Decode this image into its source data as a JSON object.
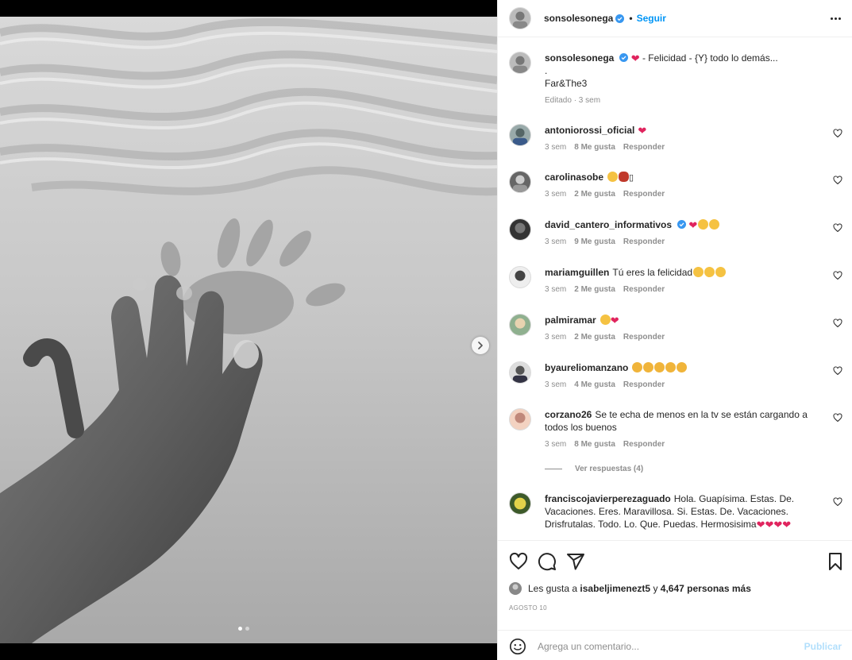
{
  "post": {
    "author": "sonsolesonega",
    "follow_label": "Seguir",
    "dot": "•",
    "caption": {
      "text": "- Felicidad - {Y} todo lo demás...",
      "line2": ".",
      "line3": "Far&The3",
      "edited": "Editado · 3 sem"
    }
  },
  "comments": [
    {
      "user": "antoniorossi_oficial",
      "text": "",
      "emojis": [
        "❤"
      ],
      "time": "3 sem",
      "likes": "8 Me gusta",
      "reply": "Responder"
    },
    {
      "user": "carolinasobe",
      "text": "",
      "emojis": [
        "🥰",
        "🌹",
        "▯"
      ],
      "time": "3 sem",
      "likes": "2 Me gusta",
      "reply": "Responder"
    },
    {
      "user": "david_cantero_informativos",
      "text": "",
      "emojis": [
        "❤",
        "😘",
        "😘"
      ],
      "time": "3 sem",
      "likes": "9 Me gusta",
      "reply": "Responder"
    },
    {
      "user": "mariamguillen",
      "text": "Tú eres la felicidad",
      "emojis": [
        "😍",
        "😍",
        "😍"
      ],
      "time": "3 sem",
      "likes": "2 Me gusta",
      "reply": "Responder"
    },
    {
      "user": "palmiramar",
      "text": "",
      "emojis": [
        "😍",
        "❤"
      ],
      "time": "3 sem",
      "likes": "2 Me gusta",
      "reply": "Responder"
    },
    {
      "user": "byaureliomanzano",
      "text": "",
      "emojis": [
        "👏",
        "👏",
        "👏",
        "👏",
        "👏"
      ],
      "time": "3 sem",
      "likes": "4 Me gusta",
      "reply": "Responder"
    },
    {
      "user": "corzano26",
      "text": "Se te echa de menos en la tv se están cargando a todos los buenos",
      "emojis": [],
      "time": "3 sem",
      "likes": "8 Me gusta",
      "reply": "Responder"
    },
    {
      "user": "franciscojavierperezaguado",
      "text": "Hola. Guapísima. Estas. De. Vacaciones. Eres. Maravillosa. Si. Estas. De. Vacaciones. Drisfrutalas. Todo. Lo. Que. Puedas. Hermosisima",
      "emojis": [
        "❤",
        "❤",
        "❤",
        "❤"
      ],
      "time": "",
      "likes": "",
      "reply": ""
    }
  ],
  "view_replies": "Ver respuestas (4)",
  "likes": {
    "prefix": "Les gusta a",
    "user": "isabeljimenezt5",
    "conj": "y",
    "count": "4,647 personas más"
  },
  "date": "AGOSTO 10",
  "comment_box": {
    "placeholder": "Agrega un comentario...",
    "publish": "Publicar"
  },
  "icons": {
    "like": "heart-outline-icon",
    "comment": "comment-bubble-icon",
    "share": "paper-plane-icon",
    "save": "bookmark-icon",
    "more": "ellipsis-icon",
    "verified": "verified-badge-icon",
    "emoji": "smiley-icon",
    "next": "chevron-right-icon"
  },
  "colors": {
    "accent": "#0095f6",
    "verified": "#3897f0",
    "red_heart": "#e0245e",
    "publish_disabled": "#b2dffc"
  },
  "carousel": {
    "slides": 2,
    "current": 1
  }
}
